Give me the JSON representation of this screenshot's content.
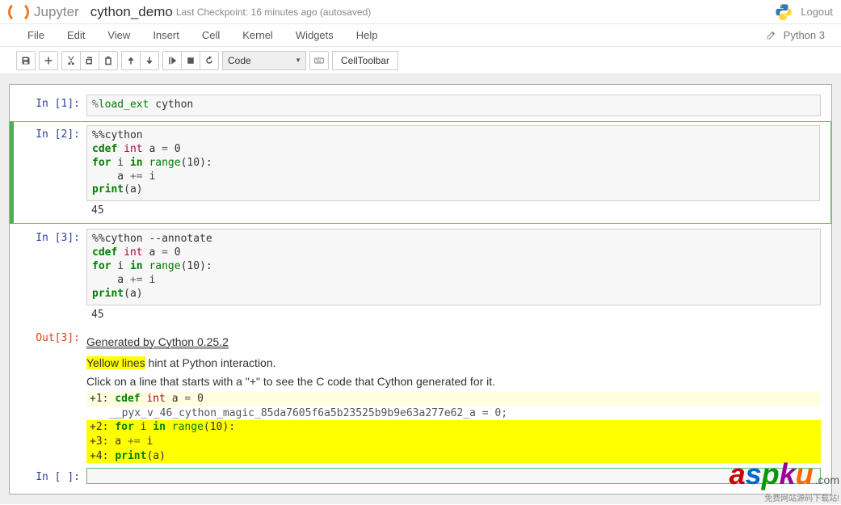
{
  "header": {
    "logo_text": "Jupyter",
    "notebook_name": "cython_demo",
    "checkpoint": "Last Checkpoint: 16 minutes ago (autosaved)",
    "logout": "Logout"
  },
  "menubar": {
    "items": [
      "File",
      "Edit",
      "View",
      "Insert",
      "Cell",
      "Kernel",
      "Widgets",
      "Help"
    ],
    "kernel": "Python 3"
  },
  "toolbar": {
    "cell_type": "Code",
    "cell_toolbar": "CellToolbar",
    "icons": {
      "save": "save-icon",
      "add": "plus-icon",
      "cut": "scissors-icon",
      "copy": "copy-icon",
      "paste": "paste-icon",
      "up": "arrow-up-icon",
      "down": "arrow-down-icon",
      "run": "step-forward-icon",
      "stop": "stop-icon",
      "restart": "refresh-icon",
      "command": "keyboard-icon"
    }
  },
  "cells": [
    {
      "prompt": "In  [1]:",
      "code_html": "<span class='op'>%</span><span class='mg'>load_ext</span> cython"
    },
    {
      "prompt": "In  [2]:",
      "code_html": "%%cython\n<span class='kw'>cdef</span> <span class='ty'>int</span> a <span class='op'>=</span> 0\n<span class='kw'>for</span> i <span class='kw'>in</span> <span class='bi'>range</span>(10):\n    a <span class='op'>+=</span> i\n<span class='kw'>print</span>(a)",
      "stdout": "45"
    },
    {
      "prompt": "In  [3]:",
      "code_html": "%%cython --annotate\n<span class='kw'>cdef</span> <span class='ty'>int</span> a <span class='op'>=</span> 0\n<span class='kw'>for</span> i <span class='kw'>in</span> <span class='bi'>range</span>(10):\n    a <span class='op'>+=</span> i\n<span class='kw'>print</span>(a)",
      "stdout": "45",
      "out_prompt": "Out[3]:",
      "annotate": {
        "generated": "Generated by Cython 0.25.2",
        "yellow_label": "Yellow lines",
        "hint_rest": " hint at Python interaction.",
        "click_hint": "Click on a line that starts with a \"+\" to see the C code that Cython generated for it.",
        "lines": [
          {
            "pre": "+1: ",
            "html": "<span class='kw'>cdef</span> <span class='ty'>int</span> a <span class='op'>=</span> 0",
            "cls": "cy-y1"
          },
          {
            "pre": "",
            "html": "  __pyx_v_46_cython_magic_85da7605f6a5b23525b9b9e63a277e62_a = 0;",
            "cls": "cy-sub"
          },
          {
            "pre": "+2: ",
            "html": "<span class='kw'>for</span> i <span class='kw'>in</span> <span class='bi'>range</span>(10):",
            "cls": "cy-y3"
          },
          {
            "pre": "+3: ",
            "html": "    a <span class='op'>+=</span> i",
            "cls": "cy-y3"
          },
          {
            "pre": "+4: ",
            "html": "<span class='kw'>print</span>(a)",
            "cls": "cy-y3"
          }
        ]
      }
    },
    {
      "prompt": "In  [ ]:",
      "code_html": ""
    }
  ],
  "watermark": {
    "text": "aspku",
    "domain": ".com",
    "sub": "免费网站源码下载站!"
  }
}
